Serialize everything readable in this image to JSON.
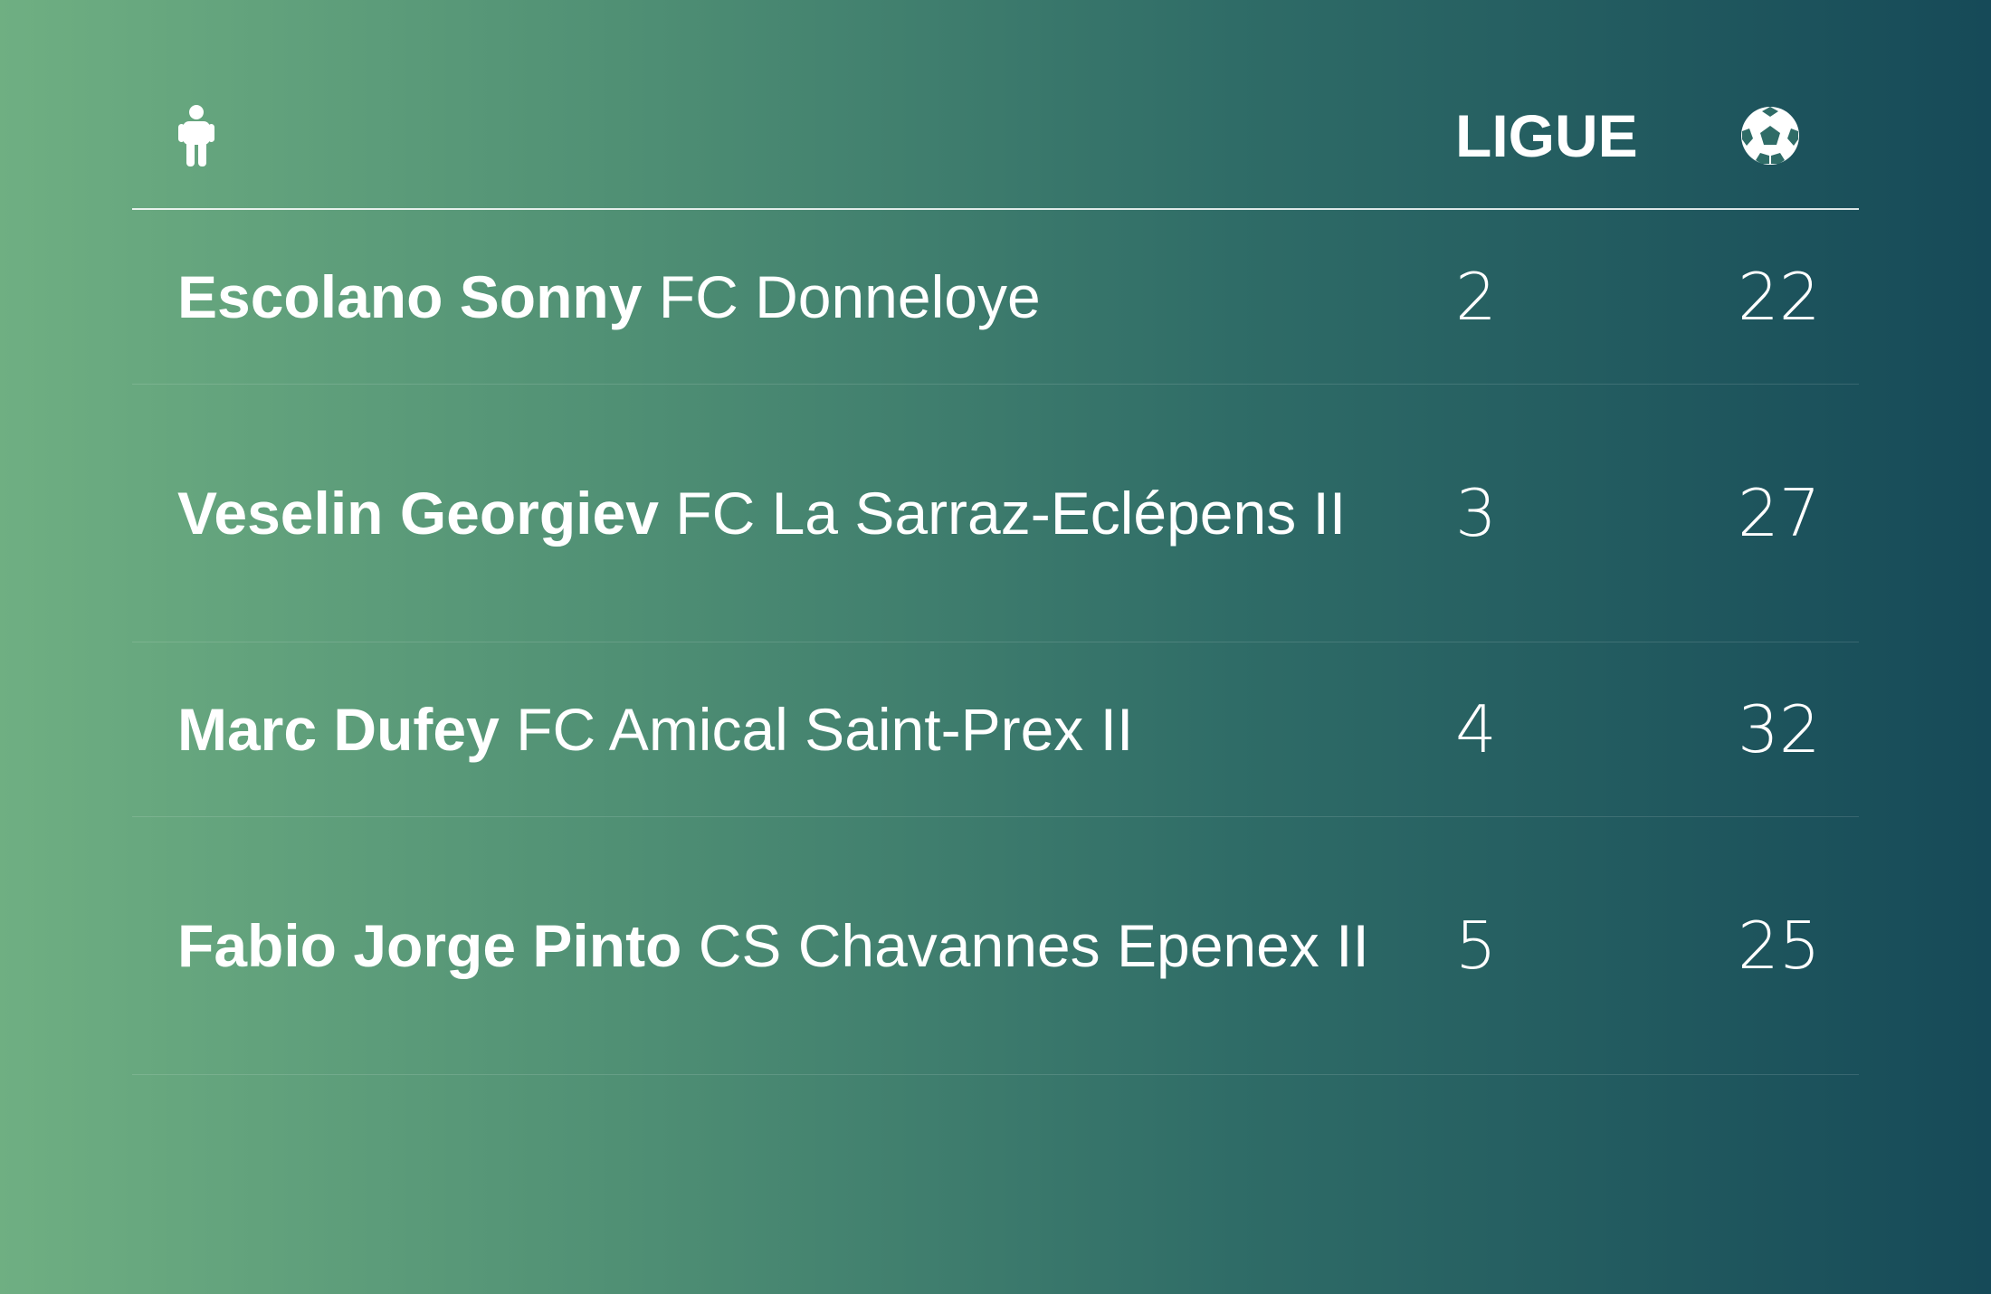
{
  "header": {
    "player_icon": "person-icon",
    "league_label": "LIGUE",
    "goals_icon": "soccer-ball-icon"
  },
  "rows": [
    {
      "player": "Escolano Sonny",
      "club": "FC Donneloye",
      "league": "2",
      "goals": "22"
    },
    {
      "player": "Veselin Georgiev",
      "club": "FC La Sarraz-Eclépens II",
      "league": "3",
      "goals": "27"
    },
    {
      "player": "Marc Dufey",
      "club": "FC Amical Saint-Prex II",
      "league": "4",
      "goals": "32"
    },
    {
      "player": "Fabio Jorge Pinto",
      "club": "CS Chavannes Epenex II",
      "league": "5",
      "goals": "25"
    }
  ]
}
